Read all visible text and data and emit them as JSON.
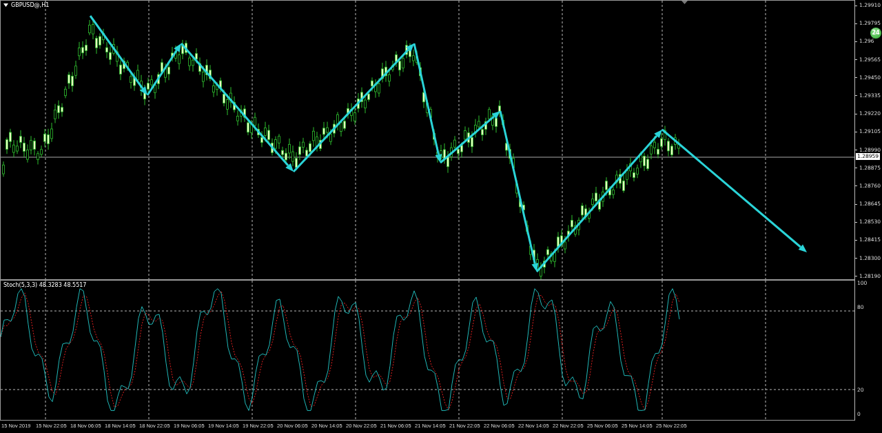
{
  "chart": {
    "title": "GBPUSD@,H1",
    "price_axis": [
      "1.29910",
      "1.29795",
      "1.296",
      "1.29565",
      "1.29450",
      "1.29335",
      "1.29220",
      "1.29105",
      "1.28990",
      "1.28875",
      "1.28760",
      "1.28645",
      "1.28530",
      "1.28415",
      "1.28300",
      "1.28190"
    ],
    "current_price": "1.28959",
    "badge": "24"
  },
  "indicator": {
    "label": "Stoch(5,3,3) 48.3283 48.5517",
    "levels": [
      "100",
      "80",
      "20",
      "0"
    ]
  },
  "time_axis": [
    "15 Nov 2019",
    "15 Nov 22:05",
    "18 Nov 06:05",
    "18 Nov 14:05",
    "18 Nov 22:05",
    "19 Nov 06:05",
    "19 Nov 14:05",
    "19 Nov 22:05",
    "20 Nov 06:05",
    "20 Nov 14:05",
    "20 Nov 22:05",
    "21 Nov 06:05",
    "21 Nov 14:05",
    "21 Nov 22:05",
    "22 Nov 06:05",
    "22 Nov 14:05",
    "22 Nov 22:05",
    "25 Nov 06:05",
    "25 Nov 14:05",
    "25 Nov 22:05"
  ]
}
